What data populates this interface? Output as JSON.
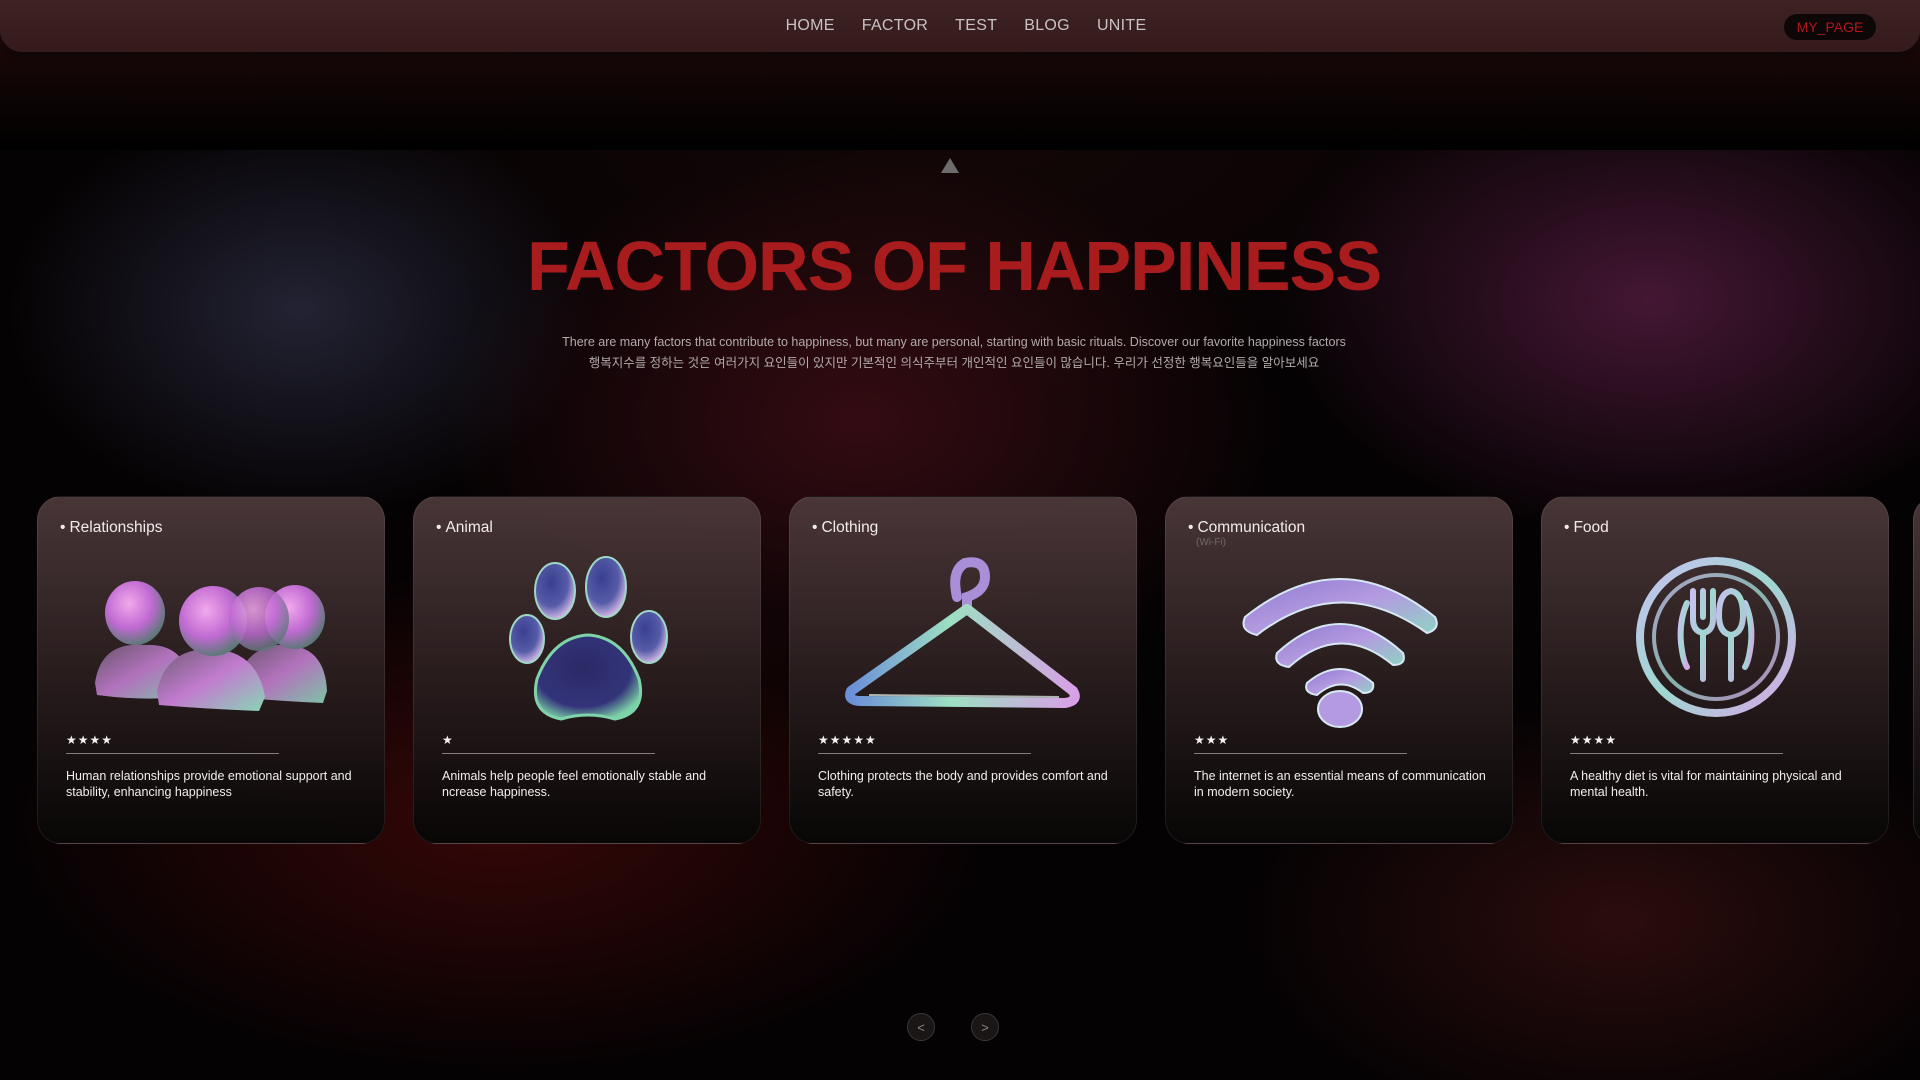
{
  "nav": {
    "links": [
      "HOME",
      "FACTOR",
      "TEST",
      "BLOG",
      "UNITE"
    ],
    "my_page": "MY_PAGE"
  },
  "hero": {
    "title": "FACTORS OF HAPPINESS",
    "desc_en": "There are many factors that contribute to happiness, but many are personal, starting with basic rituals. Discover our favorite happiness factors",
    "desc_ko": "행복지수를 정하는 것은 여러가지 요인들이 있지만 기본적인 의식주부터 개인적인 요인들이 많습니다. 우리가 선정한 행복요인들을 알아보세요"
  },
  "cards": [
    {
      "title": "Relationships",
      "subtitle": "",
      "stars": "★★★★",
      "rating": 4,
      "icon": "people-icon",
      "text": "Human relationships provide emotional support and stability, enhancing happiness"
    },
    {
      "title": "Animal",
      "subtitle": "",
      "stars": "★",
      "rating": 1,
      "icon": "paw-icon",
      "text": "Animals help people feel  emotionally stable and  ncrease happiness."
    },
    {
      "title": "Clothing",
      "subtitle": "",
      "stars": "★★★★★",
      "rating": 5,
      "icon": "hanger-icon",
      "text": "Clothing protects the body and provides comfort and safety."
    },
    {
      "title": "Communication",
      "subtitle": "(Wi-Fi)",
      "stars": "★★★",
      "rating": 3,
      "icon": "wifi-icon",
      "text": "The internet is an essential means of communication in modern society."
    },
    {
      "title": "Food",
      "subtitle": "",
      "stars": "★★★★",
      "rating": 4,
      "icon": "utensils-icon",
      "text": "A healthy diet is vital for maintaining physical and mental health."
    }
  ],
  "pager": {
    "prev": "<",
    "next": ">"
  },
  "colors": {
    "accent": "#a81c1e",
    "nav_bg": "#3a1f20"
  }
}
